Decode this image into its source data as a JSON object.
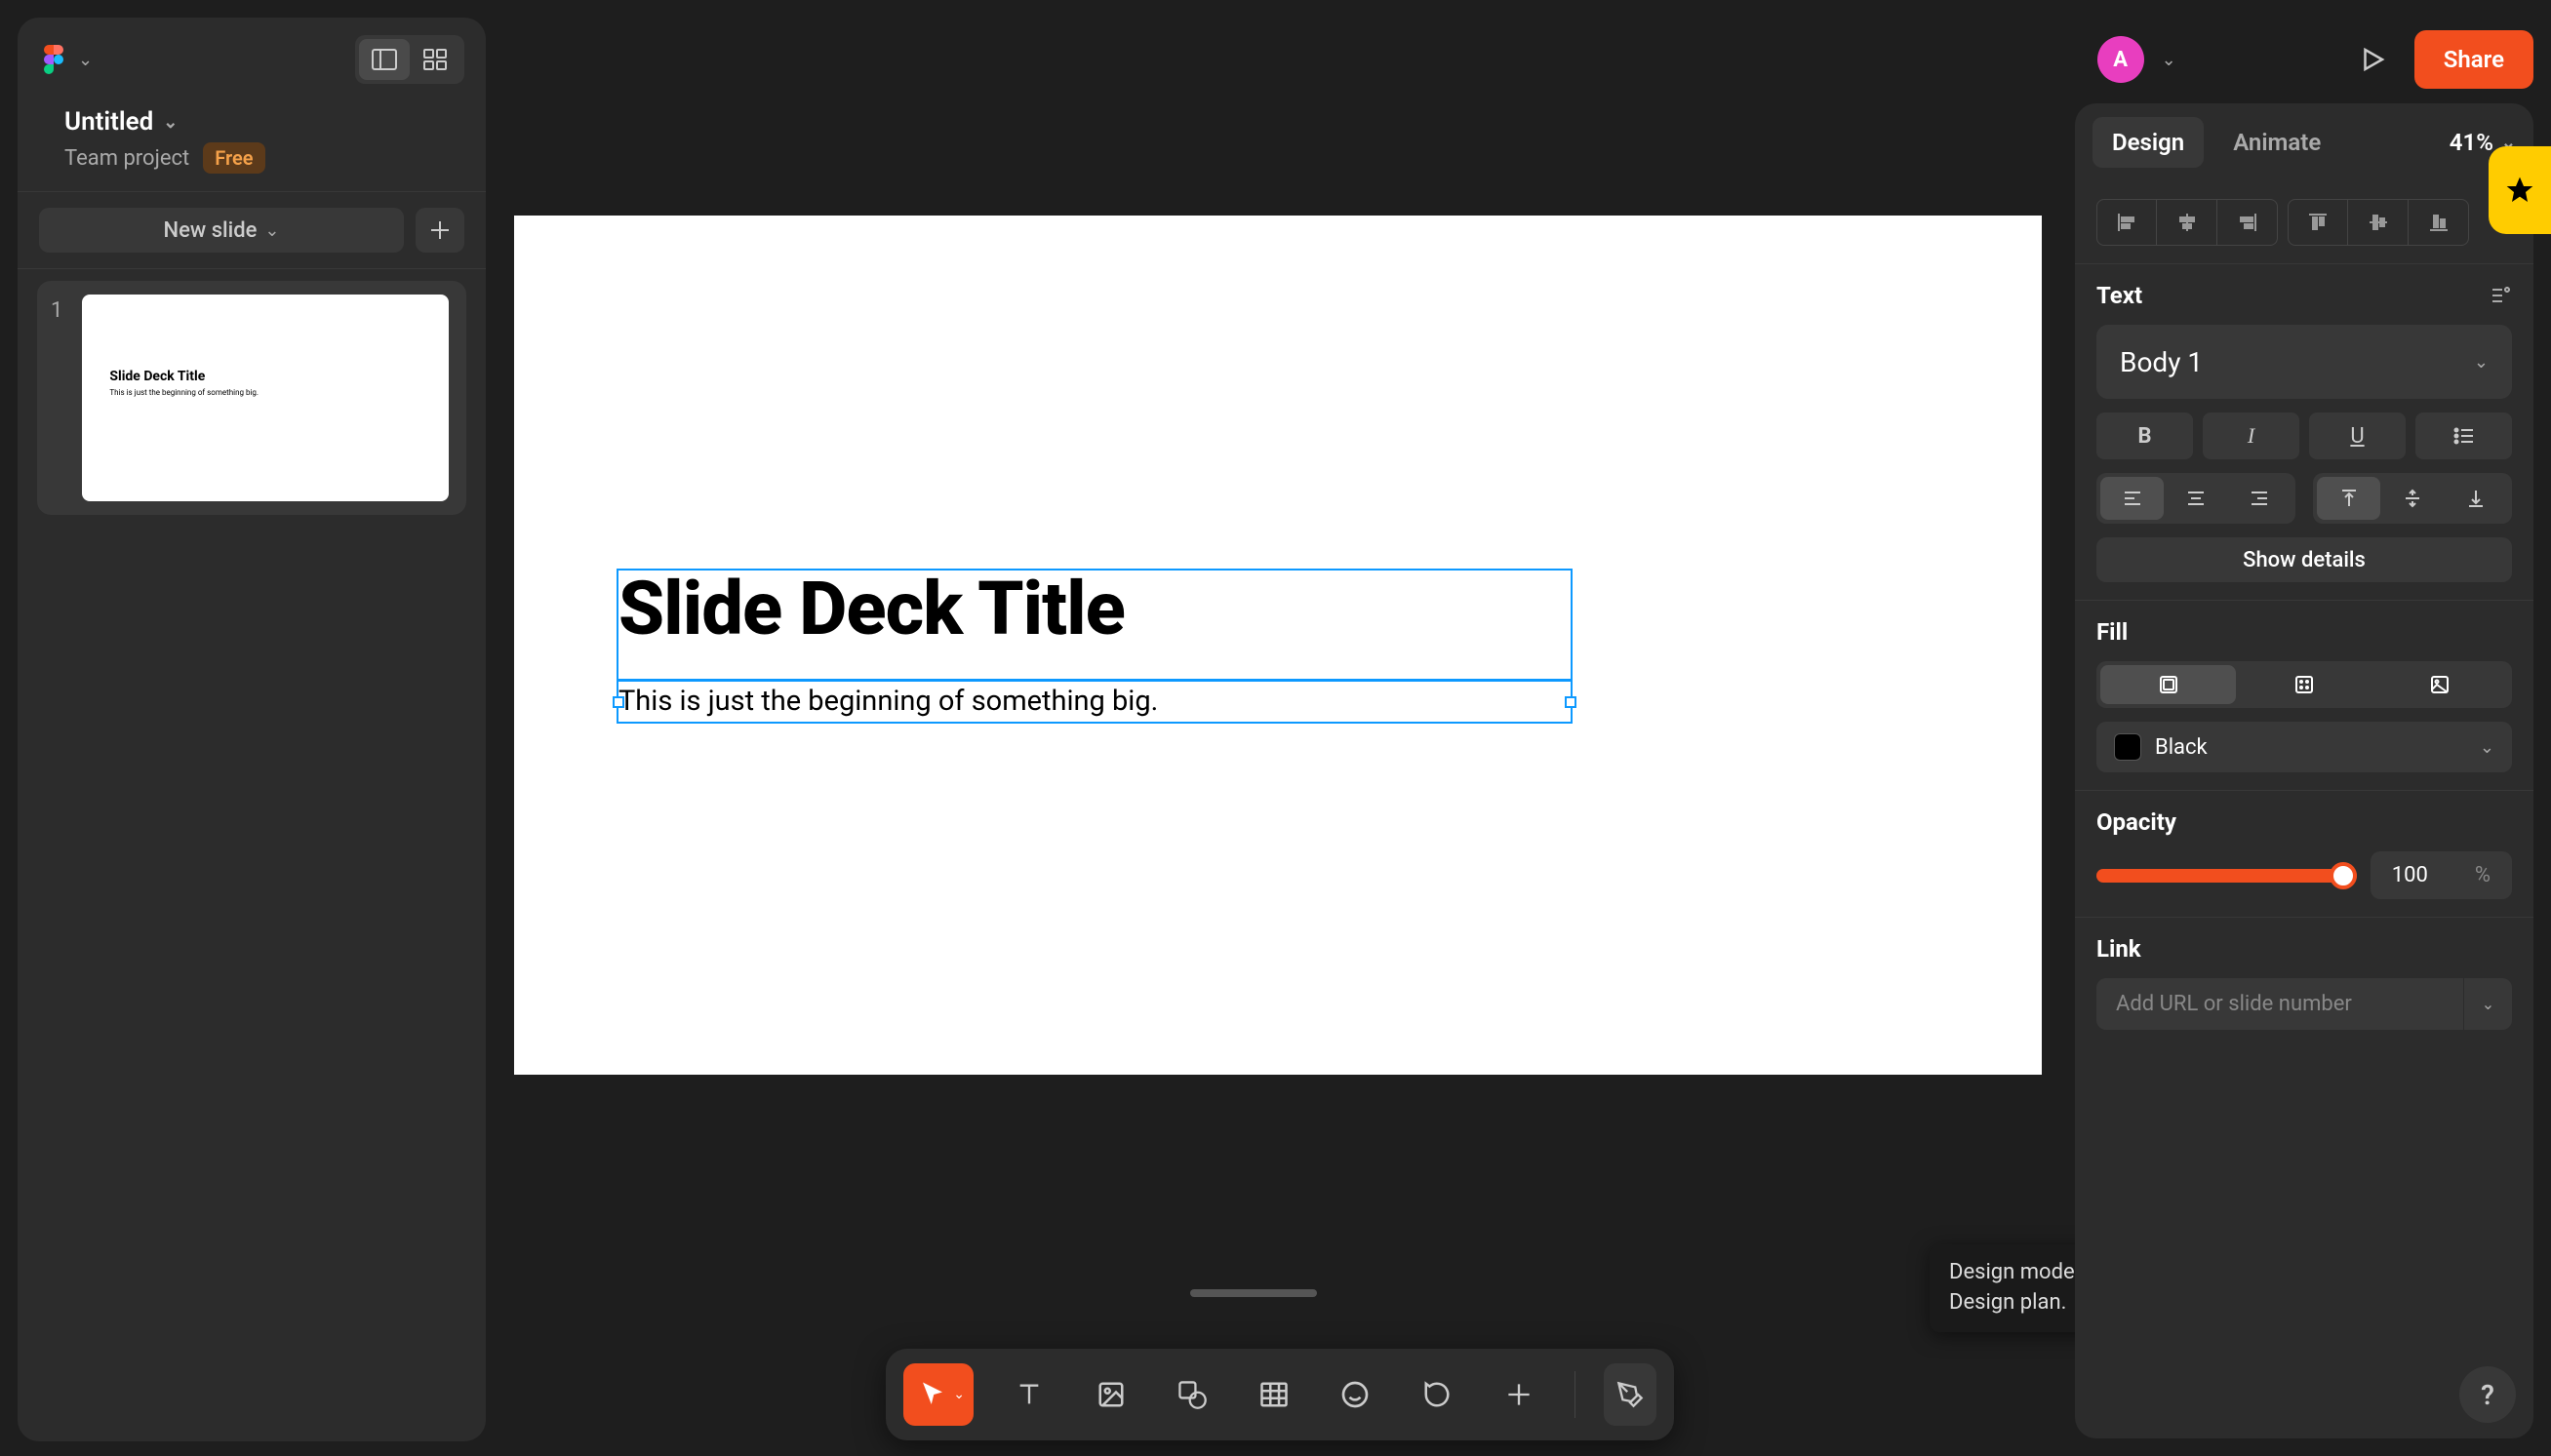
{
  "doc": {
    "title": "Untitled",
    "team": "Team project",
    "plan_badge": "Free"
  },
  "left": {
    "new_slide_label": "New slide",
    "slides": [
      {
        "num": "1",
        "thumb_title": "Slide Deck Title",
        "thumb_sub": "This is just the beginning of something big."
      }
    ]
  },
  "canvas": {
    "title": "Slide Deck Title",
    "subtitle": "This is just the beginning of something big."
  },
  "tooltip": {
    "text": "Design mode requires a Figma Design plan."
  },
  "top": {
    "avatar_initial": "A",
    "share_label": "Share"
  },
  "right": {
    "tabs": {
      "design": "Design",
      "animate": "Animate"
    },
    "zoom": "41%",
    "text_section": {
      "title": "Text",
      "font_style": "Body 1",
      "show_details": "Show details"
    },
    "fill_section": {
      "title": "Fill",
      "color_name": "Black"
    },
    "opacity_section": {
      "title": "Opacity",
      "value": "100",
      "unit": "%"
    },
    "link_section": {
      "title": "Link",
      "placeholder": "Add URL or slide number"
    }
  }
}
